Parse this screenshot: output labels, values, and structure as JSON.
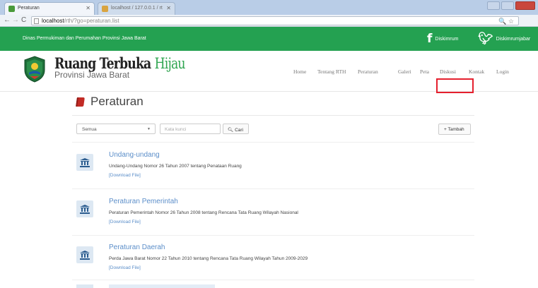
{
  "browser": {
    "tabs": [
      {
        "label": "Peraturan"
      },
      {
        "label": "localhost / 127.0.0.1 / rt"
      }
    ],
    "url_host": "localhost",
    "url_path": "/rth/?go=peraturan.list"
  },
  "topbar": {
    "org_name": "Dinas Permukiman dan Perumahan Provinsi Jawa Barat",
    "facebook_label": "Diskimrum",
    "twitter_label": "Diskimrumjabar"
  },
  "brand": {
    "title_black": "Ruang Terbuka",
    "title_green": "Hijau",
    "subtitle": "Provinsi Jawa Barat"
  },
  "nav": {
    "home": "Home",
    "tentang": "Tentang RTH",
    "peraturan": "Peraturan",
    "galeri": "Galeri",
    "peta": "Peta",
    "diskusi": "Diskusi",
    "kontak": "Kontak",
    "login": "Login"
  },
  "page": {
    "title": "Peraturan",
    "filter_selected": "Semua",
    "keyword_placeholder": "Kata kunci",
    "search_button": "Cari",
    "add_button": "Tambah"
  },
  "items": [
    {
      "title": "Undang-undang",
      "desc": "Undang-Undang Nomor 26 Tahun 2007 tentang Penataan Ruang",
      "download": "[Download File]"
    },
    {
      "title": "Peraturan Pemerintah",
      "desc": "Peraturan Pemerintah Nomor 26 Tahun 2008 tentang Rencana Tata Ruang Wilayah Nasional",
      "download": "[Download File]"
    },
    {
      "title": "Peraturan Daerah",
      "desc": "Perda Jawa Barat Nomor 22 Tahun 2010 tentang Rencana Tata Ruang Wilayah Tahun 2009-2029",
      "download": "[Download File]"
    }
  ],
  "colors": {
    "topbar": "#24a151",
    "link": "#5b8ec9",
    "highlight": "#e5202e"
  }
}
